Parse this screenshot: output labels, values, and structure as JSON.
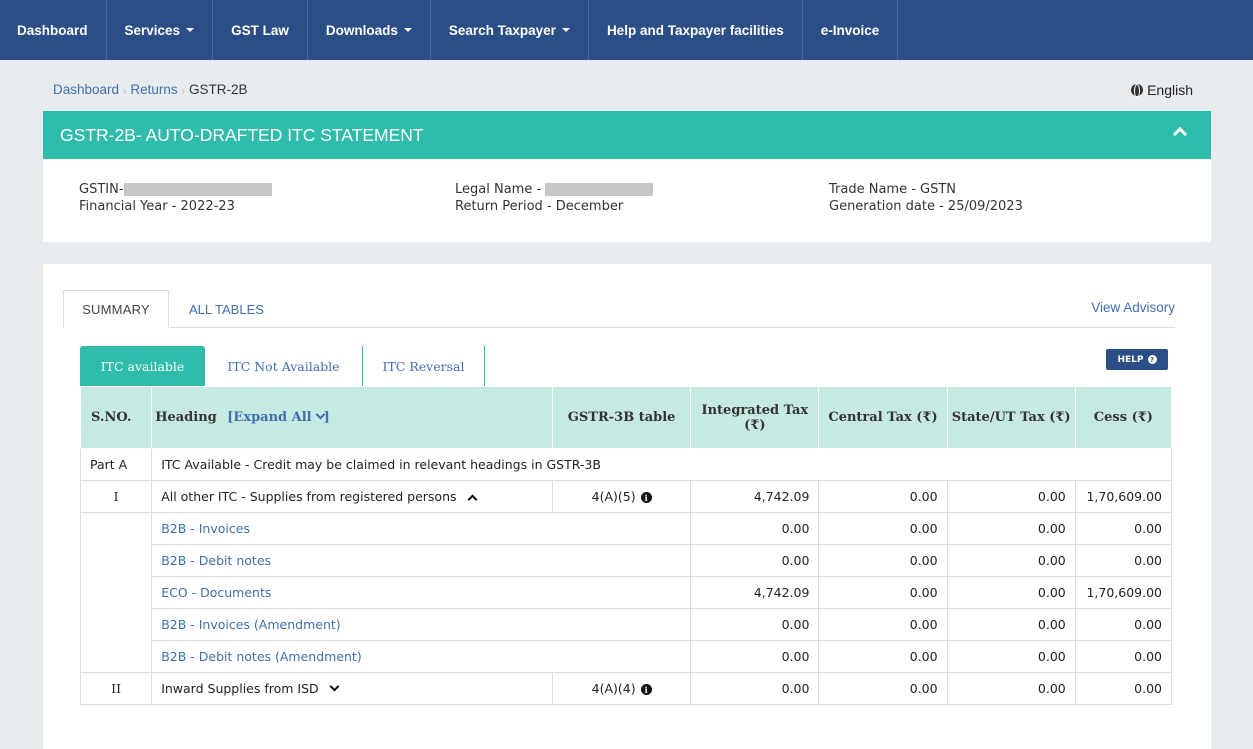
{
  "nav": {
    "items": [
      {
        "label": "Dashboard",
        "dropdown": false
      },
      {
        "label": "Services",
        "dropdown": true
      },
      {
        "label": "GST Law",
        "dropdown": false
      },
      {
        "label": "Downloads",
        "dropdown": true
      },
      {
        "label": "Search Taxpayer",
        "dropdown": true
      },
      {
        "label": "Help and Taxpayer facilities",
        "dropdown": false
      },
      {
        "label": "e-Invoice",
        "dropdown": false
      }
    ]
  },
  "breadcrumb": {
    "items": [
      "Dashboard",
      "Returns",
      "GSTR-2B"
    ]
  },
  "language": "English",
  "header": {
    "title": "GSTR-2B- AUTO-DRAFTED ITC STATEMENT"
  },
  "info": {
    "gstin_label": "GSTIN-",
    "financial_year": "Financial Year - 2022-23",
    "legal_name_label": "Legal Name -",
    "return_period": "Return Period - December",
    "trade_name": "Trade Name - GSTN",
    "generation_date": "Generation date - 25/09/2023"
  },
  "tabs": {
    "summary": "SUMMARY",
    "all_tables": "ALL TABLES",
    "view_advisory": "View Advisory"
  },
  "subtabs": {
    "itc_available": "ITC available",
    "itc_not_available": "ITC Not Available",
    "itc_reversal": "ITC Reversal"
  },
  "help_label": "HELP",
  "table": {
    "headers": {
      "sno": "S.NO.",
      "heading": "Heading",
      "expand_all": "[Expand All",
      "gstr3b": "GSTR-3B table",
      "igst": "Integrated Tax (₹)",
      "cgst": "Central Tax (₹)",
      "sgst": "State/UT Tax (₹)",
      "cess": "Cess (₹)"
    },
    "part_a": {
      "sno": "Part A",
      "text": "ITC Available - Credit may be claimed in relevant headings in GSTR-3B"
    },
    "section_1": {
      "sno": "I",
      "heading": "All other ITC - Supplies from registered persons",
      "gstr3b": "4(A)(5)",
      "igst": "4,742.09",
      "cgst": "0.00",
      "sgst": "0.00",
      "cess": "1,70,609.00"
    },
    "sub_rows": [
      {
        "heading": "B2B - Invoices",
        "igst": "0.00",
        "cgst": "0.00",
        "sgst": "0.00",
        "cess": "0.00"
      },
      {
        "heading": "B2B - Debit notes",
        "igst": "0.00",
        "cgst": "0.00",
        "sgst": "0.00",
        "cess": "0.00"
      },
      {
        "heading": "ECO - Documents",
        "igst": "4,742.09",
        "cgst": "0.00",
        "sgst": "0.00",
        "cess": "1,70,609.00"
      },
      {
        "heading": "B2B - Invoices (Amendment)",
        "igst": "0.00",
        "cgst": "0.00",
        "sgst": "0.00",
        "cess": "0.00"
      },
      {
        "heading": "B2B - Debit notes (Amendment)",
        "igst": "0.00",
        "cgst": "0.00",
        "sgst": "0.00",
        "cess": "0.00"
      }
    ],
    "section_2": {
      "sno": "II",
      "heading": "Inward Supplies from ISD",
      "gstr3b": "4(A)(4)",
      "igst": "0.00",
      "cgst": "0.00",
      "sgst": "0.00",
      "cess": "0.00"
    }
  }
}
